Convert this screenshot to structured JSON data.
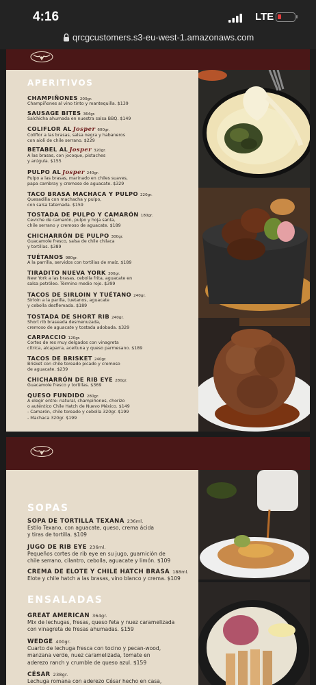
{
  "status_bar": {
    "time": "4:16",
    "network": "LTE",
    "battery_color": "#e23c3c"
  },
  "browser": {
    "url": "qrcgcustomers.s3-eu-west-1.amazonaws.com"
  },
  "page1": {
    "section": "APERITIVOS",
    "items": [
      {
        "name": "CHAMPIÑONES",
        "brand": "",
        "weight": "200gr.",
        "desc": [
          "Champiñones al vino tinto y mantequilla. $139"
        ]
      },
      {
        "name": "SAUSAGE BITES",
        "brand": "",
        "weight": "364gr.",
        "desc": [
          "Salchicha ahumada en nuestra salsa BBQ. $149"
        ]
      },
      {
        "name": "COLIFLOR AL",
        "brand": "Josper",
        "weight": "600gr.",
        "desc": [
          "Coliflor a las brasas, salsa negra y habaneros",
          "con aioli de chile serrano. $229"
        ]
      },
      {
        "name": "BETABEL AL",
        "brand": "Josper",
        "weight": "320gr.",
        "desc": [
          "A las brasas, con jocoque, pistaches",
          "y arúgula. $155"
        ]
      },
      {
        "name": "PULPO AL",
        "brand": "Josper",
        "weight": "240gr.",
        "desc": [
          "Pulpo a las brasas, marinado en chiles suaves,",
          "papa cambray y cremoso de aguacate. $329"
        ]
      },
      {
        "name": "TACO BRASA MACHACA Y PULPO",
        "brand": "",
        "weight": "220gr.",
        "desc": [
          "Quesadilla con machacha y pulpo,",
          "con salsa tatemada. $159"
        ]
      },
      {
        "name": "TOSTADA DE PULPO Y CAMARÓN",
        "brand": "",
        "weight": "180gr.",
        "desc": [
          "Ceviche de camarón, pulpo y hoja santa,",
          "chile serrano y cremoso de aguacate. $189"
        ]
      },
      {
        "name": "CHICHARRÓN DE PULPO",
        "brand": "",
        "weight": "300gr.",
        "desc": [
          "Guacamole fresco, salsa de chile chilaca",
          "y tortillas. $389"
        ]
      },
      {
        "name": "TUÉTANOS",
        "brand": "",
        "weight": "980gr.",
        "desc": [
          "A la parrilla, servidos con tortillas de maíz. $189"
        ]
      },
      {
        "name": "TIRADITO NUEVA YORK",
        "brand": "",
        "weight": "300gr.",
        "desc": [
          "New York a las brasas, cebolla frita, aguacate en",
          "salsa petróleo. Término medio rojo. $399"
        ]
      },
      {
        "name": "TACOS DE SIRLOIN Y TUÉTANO",
        "brand": "",
        "weight": "240gr.",
        "desc": [
          "Sirloin a la parilla, tuetanos, aguacate",
          "y cebolla desflemada. $189"
        ]
      },
      {
        "name": "TOSTADA DE SHORT RIB",
        "brand": "",
        "weight": "240gr.",
        "desc": [
          "Short rib braseada desmenuzada,",
          "cremoso de aguacate y tostada adobada. $329"
        ]
      },
      {
        "name": "CARPACCIO",
        "brand": "",
        "weight": "120gr.",
        "desc": [
          "Cortes de res muy delgados con vinagreta",
          "cítrica, alcaparra, aceituna y queso parmesano. $189"
        ]
      },
      {
        "name": "TACOS DE BRISKET",
        "brand": "",
        "weight": "240gr.",
        "desc": [
          "Brisket con chile toreado picado y cremoso",
          "de aguacate. $239"
        ]
      },
      {
        "name": "CHICHARRÓN DE RIB EYE",
        "brand": "",
        "weight": "280gr.",
        "desc": [
          "Guacamole fresco y tortillas. $369"
        ]
      },
      {
        "name": "QUESO FUNDIDO",
        "brand": "",
        "weight": "280gr.",
        "desc": [
          "A elegir entre: natural, champiñones, chorizo",
          "o auténtico Chile Hatch de Nuevo México. $149",
          "- Camarón, chile toreado y cebolla 320gr. $199",
          "- Machaca 320gr. $199"
        ]
      }
    ]
  },
  "page2": {
    "section_soups": "SOPAS",
    "soups": [
      {
        "name": "SOPA DE TORTILLA TEXANA",
        "weight": "236ml.",
        "desc": [
          "Estilo Texano, con aguacate, queso, crema ácida",
          "y tiras de tortilla. $109"
        ]
      },
      {
        "name": "JUGO DE RIB EYE",
        "weight": "236ml.",
        "desc": [
          "Pequeños  cortes de rib eye en su jugo, guarnición de",
          "chile serrano, cilantro, cebolla, aguacate y limón. $109"
        ]
      },
      {
        "name": "CREMA DE ELOTE Y CHILE HATCH BRASA",
        "weight": "188ml.",
        "desc": [
          "Elote y chile hatch a las brasas, vino blanco y crema.  $109"
        ]
      }
    ],
    "section_salads": "ENSALADAS",
    "salads": [
      {
        "name": "GREAT AMERICAN",
        "weight": "364gr.",
        "desc": [
          "Mix de lechugas, fresas, queso feta y nuez caramelizada",
          "con vinagreta de fresas ahumadas.  $159"
        ]
      },
      {
        "name": "WEDGE",
        "weight": "400gr.",
        "desc": [
          "Cuarto de lechuga fresca con tocino y pecan-wood,",
          "manzana verde, nuez caramelizada, tomate en",
          "aderezo ranch y crumble de queso azul.  $159"
        ]
      },
      {
        "name": "CÉSAR",
        "weight": "238gr.",
        "desc": [
          "Lechuga romana con aderezo César hecho en casa,"
        ]
      }
    ]
  }
}
